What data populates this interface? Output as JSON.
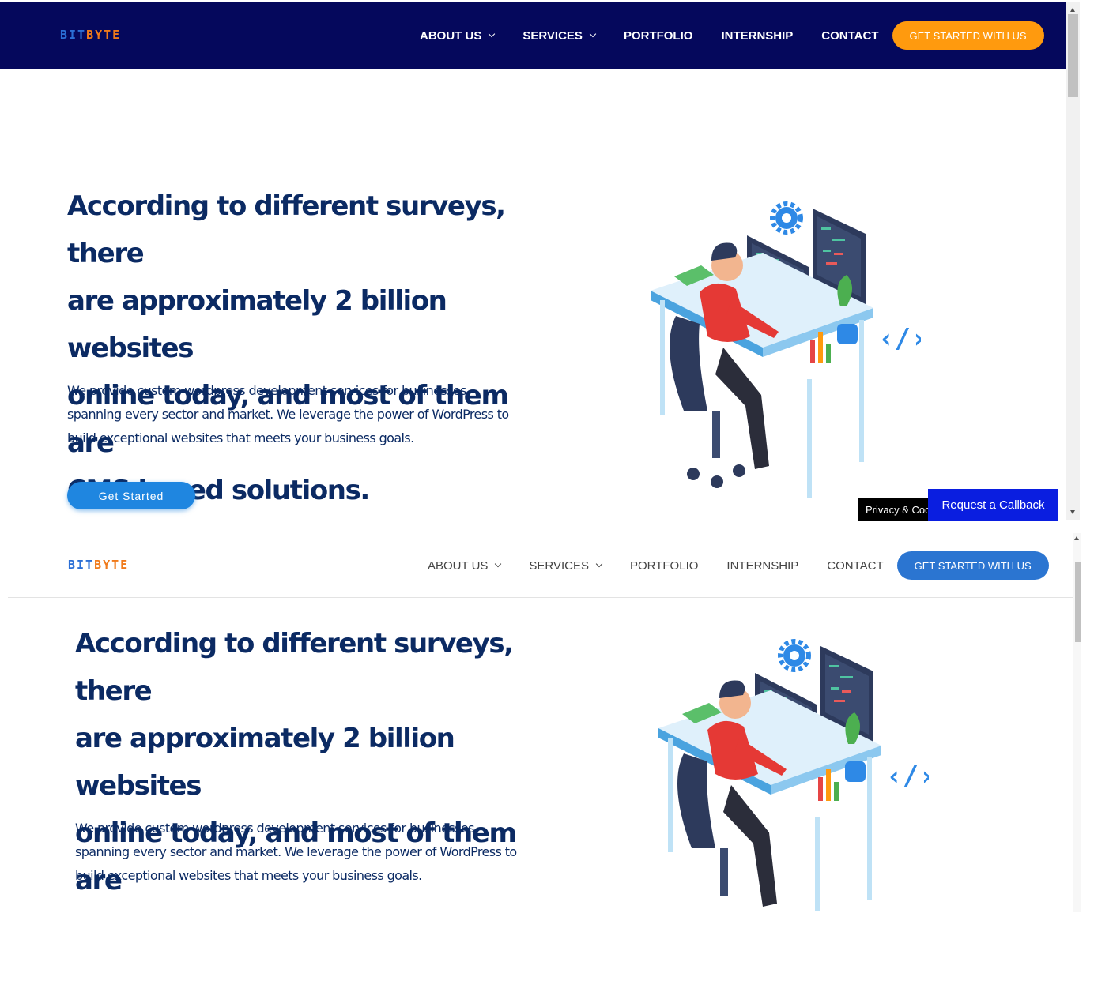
{
  "brand": {
    "logo_part1": "BIT",
    "logo_part2": "BYTE",
    "logo_alt_part2": "BYTE"
  },
  "nav": {
    "items": [
      "ABOUT US",
      "SERVICES",
      "PORTFOLIO",
      "INTERNSHIP",
      "CONTACT"
    ],
    "cta": "GET STARTED WITH US"
  },
  "hero": {
    "title_lines": [
      "According to different surveys, there",
      "are approximately 2 billion websites",
      "online today, and most of them are",
      "CMS based solutions."
    ],
    "body_lines": [
      "We provide custom wordpress development services for businesses",
      "spanning every sector and market. We leverage the power of WordPress to",
      "build exceptional websites that meets your business goals."
    ],
    "button": "Get Started"
  },
  "widgets": {
    "privacy": "Privacy & Coo",
    "callback": "Request a Callback"
  },
  "colors": {
    "nav_dark": "#05085c",
    "cta_orange": "#ff9a0e",
    "cta_blue": "#2b75d1",
    "heading": "#0b2a63",
    "callback": "#0a1ee0"
  },
  "icons": [
    "chevron-down-icon",
    "gear-icon",
    "code-icon",
    "developer-illustration"
  ]
}
